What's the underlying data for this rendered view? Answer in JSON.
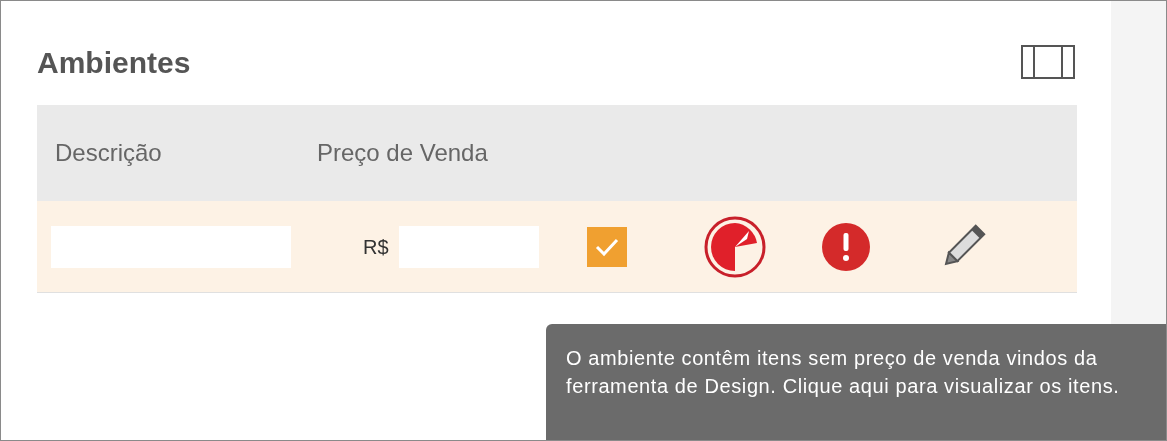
{
  "title": "Ambientes",
  "table": {
    "columns": [
      "Descrição",
      "Preço de Venda"
    ],
    "rows": [
      {
        "description": "",
        "currency": "R$",
        "price": "",
        "checked": true
      }
    ]
  },
  "tooltip": "O ambiente contêm itens sem preço de venda vindos da ferramenta de Design. Clique aqui para visualizar os itens."
}
